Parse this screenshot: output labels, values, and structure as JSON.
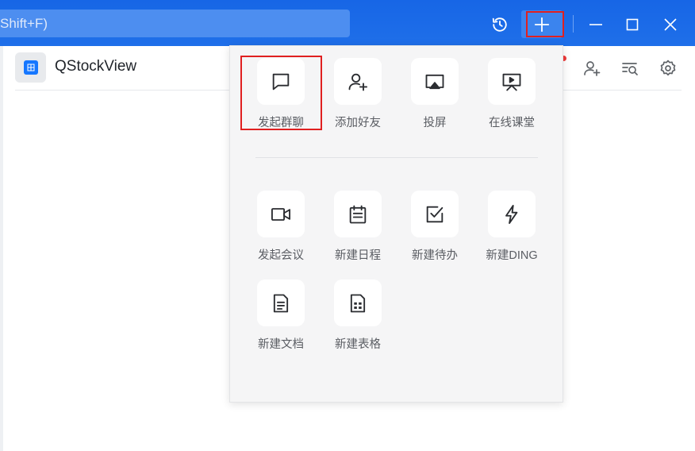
{
  "titlebar": {
    "search_placeholder": "Shift+F)",
    "icons": [
      "history-icon",
      "plus-icon",
      "minimize-icon",
      "maximize-icon",
      "close-icon"
    ]
  },
  "chat": {
    "title": "QStockView",
    "header_icons": [
      "add-member-icon",
      "search-history-icon",
      "settings-icon"
    ]
  },
  "popup": {
    "row1": [
      {
        "label": "发起群聊",
        "icon": "chat-bubble-icon"
      },
      {
        "label": "添加好友",
        "icon": "add-friend-icon"
      },
      {
        "label": "投屏",
        "icon": "screen-cast-icon"
      },
      {
        "label": "在线课堂",
        "icon": "online-class-icon"
      }
    ],
    "row2": [
      {
        "label": "发起会议",
        "icon": "video-meeting-icon"
      },
      {
        "label": "新建日程",
        "icon": "calendar-icon"
      },
      {
        "label": "新建待办",
        "icon": "todo-icon"
      },
      {
        "label": "新建DING",
        "icon": "lightning-icon"
      }
    ],
    "row3": [
      {
        "label": "新建文档",
        "icon": "document-icon"
      },
      {
        "label": "新建表格",
        "icon": "spreadsheet-icon"
      }
    ]
  },
  "colors": {
    "titlebar": "#1a73e8",
    "highlight": "#e02020",
    "popup_bg": "#f5f5f6"
  }
}
